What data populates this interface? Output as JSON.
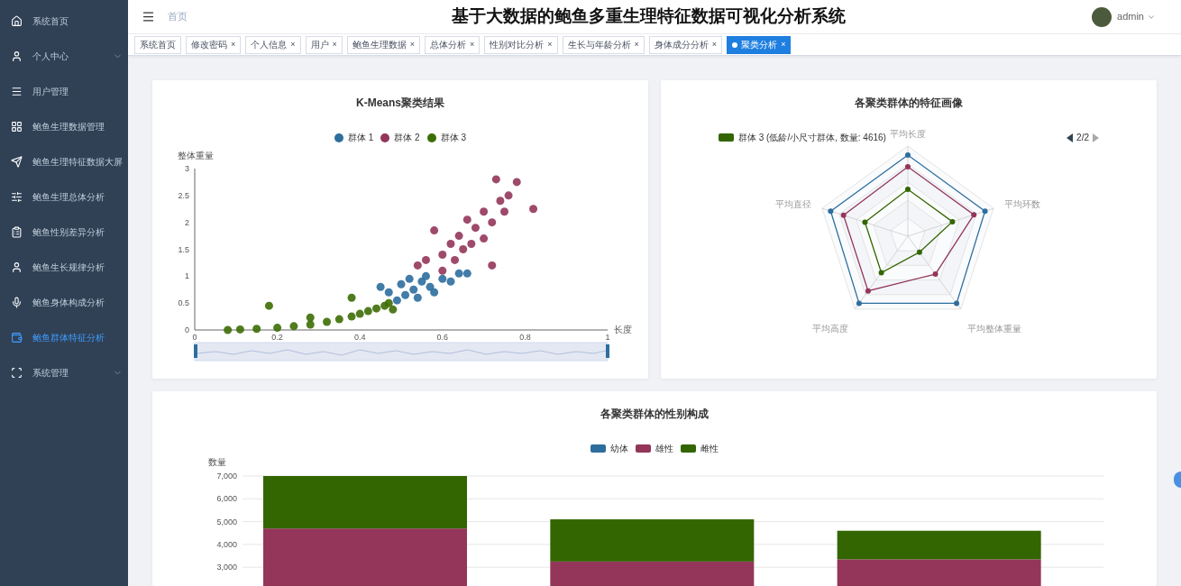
{
  "sidebar": {
    "items": [
      {
        "label": "系统首页",
        "kind": "link",
        "selected": false
      },
      {
        "label": "个人中心",
        "kind": "submenu",
        "selected": false
      },
      {
        "label": "用户管理",
        "kind": "link",
        "selected": false
      },
      {
        "label": "鲍鱼生理数据管理",
        "kind": "link",
        "selected": false
      },
      {
        "label": "鲍鱼生理特征数据大屏",
        "kind": "link",
        "selected": false
      },
      {
        "label": "鲍鱼生理总体分析",
        "kind": "link",
        "selected": false
      },
      {
        "label": "鲍鱼性别差异分析",
        "kind": "link",
        "selected": false
      },
      {
        "label": "鲍鱼生长规律分析",
        "kind": "link",
        "selected": false
      },
      {
        "label": "鲍鱼身体构成分析",
        "kind": "link",
        "selected": false
      },
      {
        "label": "鲍鱼群体特征分析",
        "kind": "link",
        "selected": true
      },
      {
        "label": "系统管理",
        "kind": "submenu",
        "selected": false
      }
    ]
  },
  "header": {
    "breadcrumb": "首页",
    "title": "基于大数据的鲍鱼多重生理特征数据可视化分析系统",
    "user": "admin"
  },
  "tabs": [
    {
      "label": "系统首页",
      "selected": false
    },
    {
      "label": "修改密码",
      "selected": false,
      "close": "×"
    },
    {
      "label": "个人信息",
      "selected": false,
      "close": "×"
    },
    {
      "label": "用户",
      "selected": false,
      "close": "×"
    },
    {
      "label": "鲍鱼生理数据",
      "selected": false,
      "close": "×"
    },
    {
      "label": "总体分析",
      "selected": false,
      "close": "×"
    },
    {
      "label": "性别对比分析",
      "selected": false,
      "close": "×"
    },
    {
      "label": "生长与年龄分析",
      "selected": false,
      "close": "×"
    },
    {
      "label": "身体成分分析",
      "selected": false,
      "close": "×"
    },
    {
      "label": "聚类分析",
      "selected": true,
      "close": "×"
    }
  ],
  "scatter": {
    "chart_data": {
      "type": "scatter",
      "title": "K-Means聚类结果",
      "xlabel": "长度",
      "ylabel": "整体重量",
      "xlim": [
        0,
        1
      ],
      "ylim": [
        0,
        3
      ],
      "xticks": [
        0,
        0.2,
        0.4,
        0.6,
        0.8,
        1
      ],
      "yticks": [
        0,
        0.5,
        1,
        1.5,
        2,
        2.5,
        3
      ],
      "series": [
        {
          "name": "群体 1",
          "color": "#2e6e9e",
          "x": [
            0.45,
            0.47,
            0.49,
            0.5,
            0.51,
            0.52,
            0.53,
            0.54,
            0.55,
            0.56,
            0.57,
            0.58,
            0.6,
            0.62,
            0.64,
            0.66
          ],
          "values": [
            0.8,
            0.7,
            0.55,
            0.85,
            0.65,
            0.95,
            0.75,
            0.6,
            0.9,
            1.0,
            0.8,
            0.7,
            0.95,
            0.9,
            1.05,
            1.05
          ]
        },
        {
          "name": "群体 2",
          "color": "#93365a",
          "x": [
            0.54,
            0.56,
            0.58,
            0.6,
            0.6,
            0.62,
            0.63,
            0.64,
            0.65,
            0.66,
            0.67,
            0.68,
            0.7,
            0.7,
            0.72,
            0.72,
            0.73,
            0.74,
            0.75,
            0.76,
            0.78,
            0.82
          ],
          "values": [
            1.2,
            1.3,
            1.85,
            1.1,
            1.4,
            1.6,
            1.3,
            1.75,
            1.5,
            2.05,
            1.6,
            1.9,
            1.7,
            2.2,
            2.0,
            1.2,
            2.8,
            2.4,
            2.2,
            2.5,
            2.75,
            2.25
          ]
        },
        {
          "name": "群体 3",
          "color": "#3d6e05",
          "x": [
            0.08,
            0.11,
            0.15,
            0.18,
            0.2,
            0.24,
            0.28,
            0.28,
            0.32,
            0.35,
            0.38,
            0.38,
            0.4,
            0.42,
            0.44,
            0.46,
            0.47,
            0.48
          ],
          "values": [
            0.0,
            0.01,
            0.02,
            0.45,
            0.04,
            0.07,
            0.1,
            0.23,
            0.15,
            0.2,
            0.6,
            0.25,
            0.3,
            0.35,
            0.4,
            0.45,
            0.5,
            0.38
          ]
        }
      ]
    }
  },
  "radar": {
    "title": "各聚类群体的特征画像",
    "legend": {
      "label": "群体 3 (低龄/小尺寸群体, 数量: 4616)",
      "color": "#336600"
    },
    "pager": "2/2",
    "indicators": [
      "平均长度",
      "平均直径",
      "平均环数",
      "平均高度",
      "平均整体重量"
    ]
  },
  "bars": {
    "chart_data": {
      "type": "bar",
      "title": "各聚类群体的性别构成",
      "ylabel": "数量",
      "stacked": true,
      "grid": true,
      "ylim": [
        0,
        7000
      ],
      "yticks": [
        {
          "value": 3000,
          "label": "3,000"
        },
        {
          "value": 4000,
          "label": "4,000"
        },
        {
          "value": 5000,
          "label": "5,000"
        },
        {
          "value": 6000,
          "label": "6,000"
        },
        {
          "value": 7000,
          "label": "7,000"
        }
      ],
      "series": [
        {
          "name": "幼体",
          "color": "#2e6e9e",
          "values": [
            null,
            null,
            null
          ]
        },
        {
          "name": "雄性",
          "color": "#93365a",
          "values": [
            4700,
            3250,
            3350
          ]
        },
        {
          "name": "雌性",
          "color": "#336600",
          "values": [
            2300,
            1850,
            1250
          ]
        }
      ]
    }
  }
}
